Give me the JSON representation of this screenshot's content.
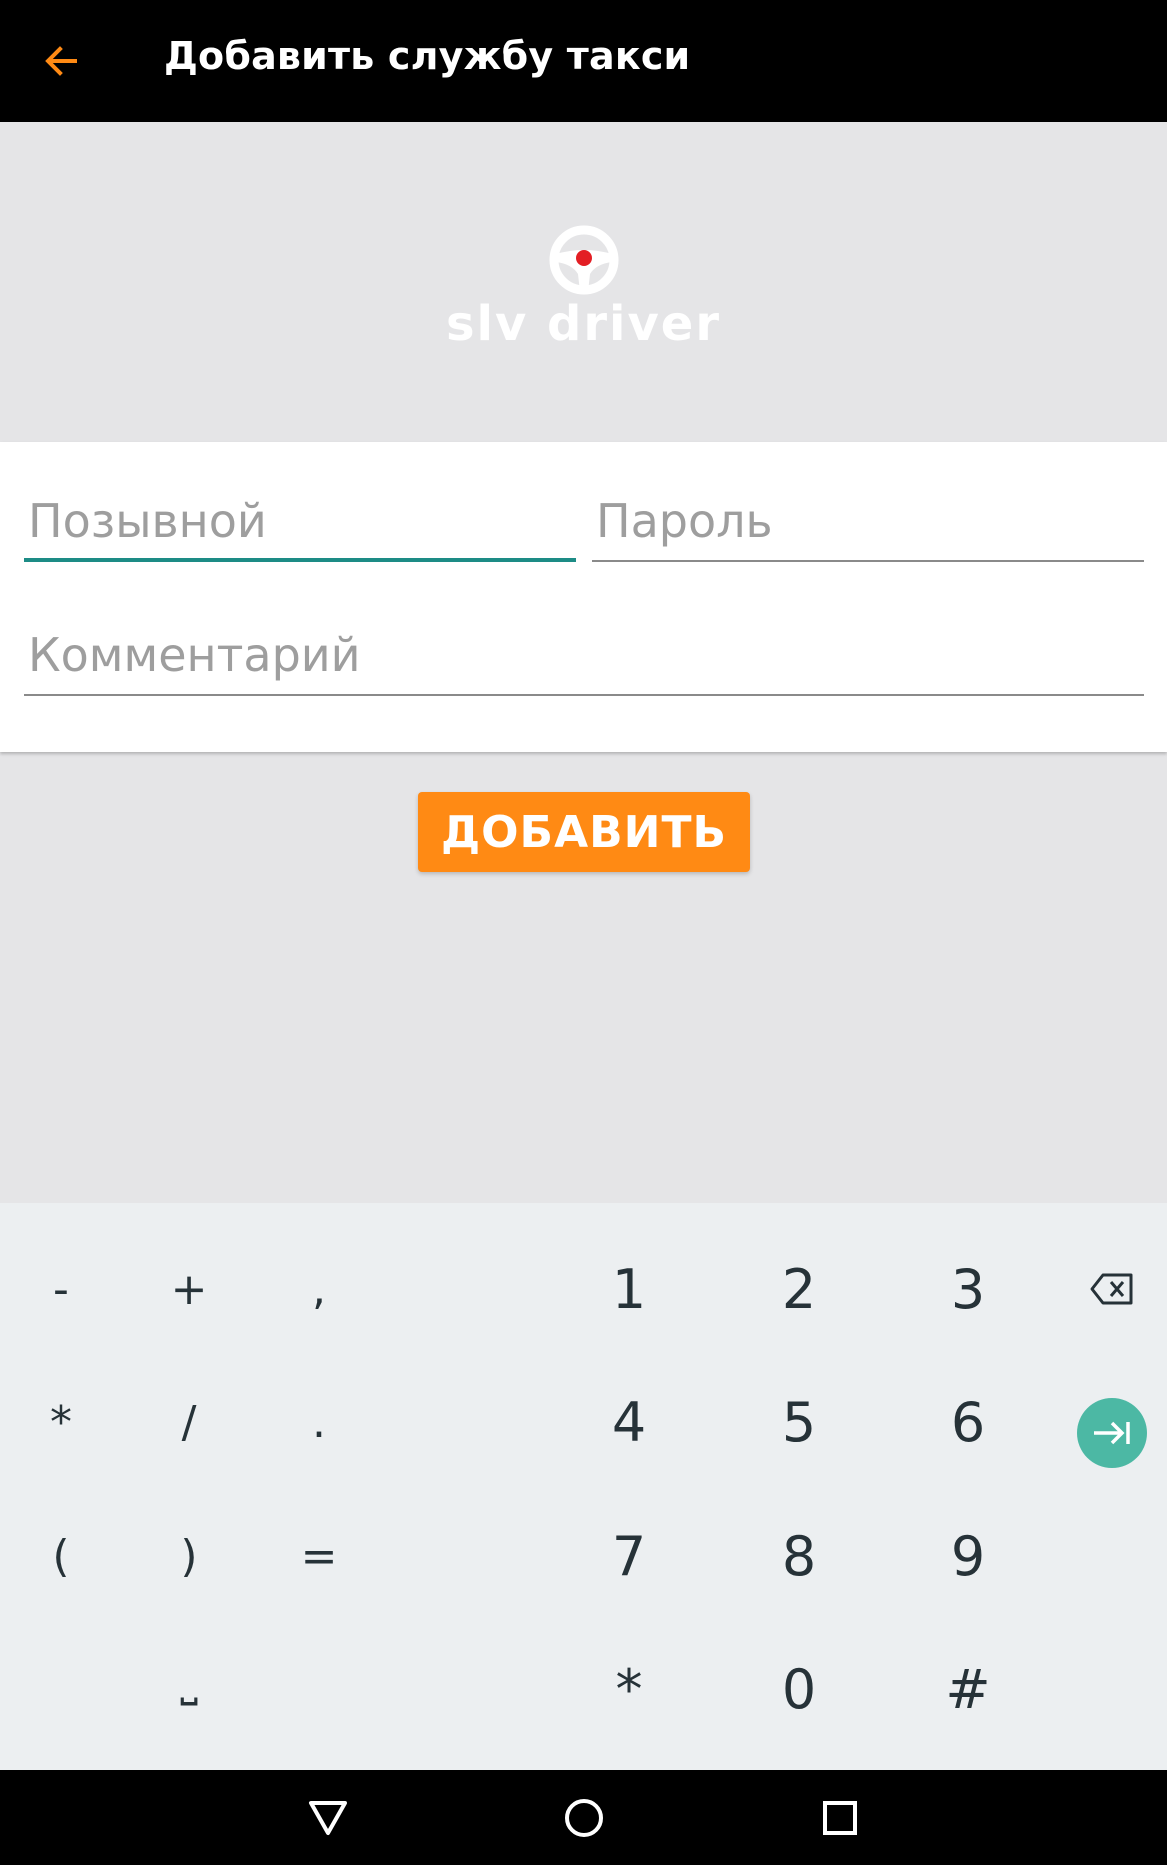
{
  "header": {
    "title": "Добавить службу такси",
    "back_icon": "arrow-left-icon",
    "accent_color": "#ff8a14"
  },
  "banner": {
    "logo_text": "slv driver",
    "logo_icon": "steering-wheel-icon"
  },
  "form": {
    "callsign_placeholder": "Позывной",
    "password_placeholder": "Пароль",
    "comment_placeholder": "Комментарий",
    "focus_color": "#1d8c86"
  },
  "add_button": {
    "label": "ДОБАВИТЬ",
    "color": "#ff8a14"
  },
  "keyboard": {
    "row1": {
      "sym1": "-",
      "sym2": "+",
      "sym3": ",",
      "n1": "1",
      "n2": "2",
      "n3": "3"
    },
    "row2": {
      "sym1": "*",
      "sym2": "/",
      "sym3": ".",
      "n1": "4",
      "n2": "5",
      "n3": "6"
    },
    "row3": {
      "sym1": "(",
      "sym2": ")",
      "sym3": "=",
      "n1": "7",
      "n2": "8",
      "n3": "9"
    },
    "row4": {
      "space": "⎵",
      "n1": "*",
      "n2": "0",
      "n3": "#"
    },
    "backspace_icon": "backspace-icon",
    "enter_icon": "tab-next-icon",
    "enter_color": "#4cb8a4"
  },
  "navbar": {
    "back_icon": "nav-back-triangle-icon",
    "home_icon": "nav-home-circle-icon",
    "recents_icon": "nav-recents-square-icon"
  }
}
